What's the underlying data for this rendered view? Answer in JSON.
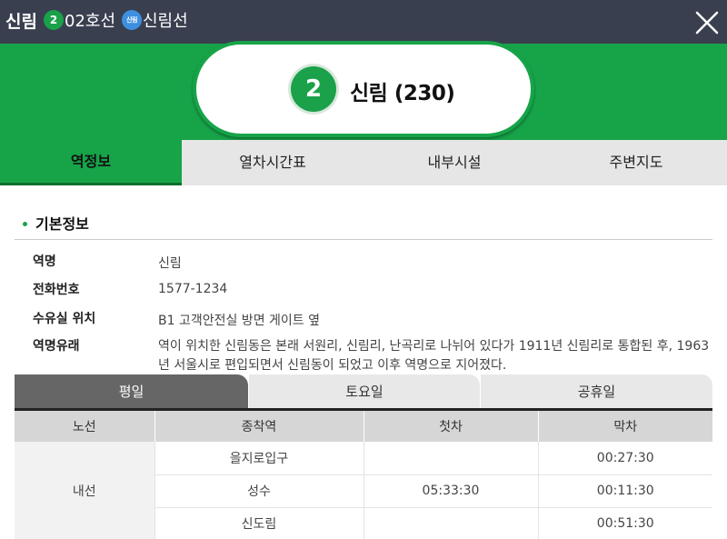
{
  "header": {
    "station": "신림",
    "line2_badge": "2",
    "line2_label": "02호선",
    "sillim_badge": "신림",
    "sillim_label": "신림선",
    "close_icon": "close-icon"
  },
  "hero": {
    "badge": "2",
    "name": "신림 (230)",
    "accent_color": "#17a449"
  },
  "tabs": [
    {
      "label": "역정보",
      "active": true
    },
    {
      "label": "열차시간표",
      "active": false
    },
    {
      "label": "내부시설",
      "active": false
    },
    {
      "label": "주변지도",
      "active": false
    }
  ],
  "basic_info": {
    "title": "기본정보",
    "rows": [
      {
        "label": "역명",
        "value": "신림"
      },
      {
        "label": "전화번호",
        "value": "1577-1234"
      },
      {
        "label": "수유실 위치",
        "value": "B1 고객안전실 방면 게이트 옆"
      },
      {
        "label": "역명유래",
        "value": "역이 위치한 신림동은 본래 서원리, 신림리, 난곡리로 나뉘어 있다가 1911년 신림리로 통합된 후, 1963년 서울시로 편입되면서 신림동이 되었고 이후 역명으로 지어졌다."
      }
    ]
  },
  "day_tabs": [
    {
      "label": "평일",
      "active": true
    },
    {
      "label": "토요일",
      "active": false
    },
    {
      "label": "공휴일",
      "active": false
    }
  ],
  "timetable": {
    "headers": [
      "노선",
      "종착역",
      "첫차",
      "막차"
    ],
    "line_name": "내선",
    "rows": [
      {
        "terminal": "을지로입구",
        "first": "",
        "last": "00:27:30"
      },
      {
        "terminal": "성수",
        "first": "05:33:30",
        "last": "00:11:30"
      },
      {
        "terminal": "신도림",
        "first": "",
        "last": "00:51:30"
      }
    ]
  }
}
